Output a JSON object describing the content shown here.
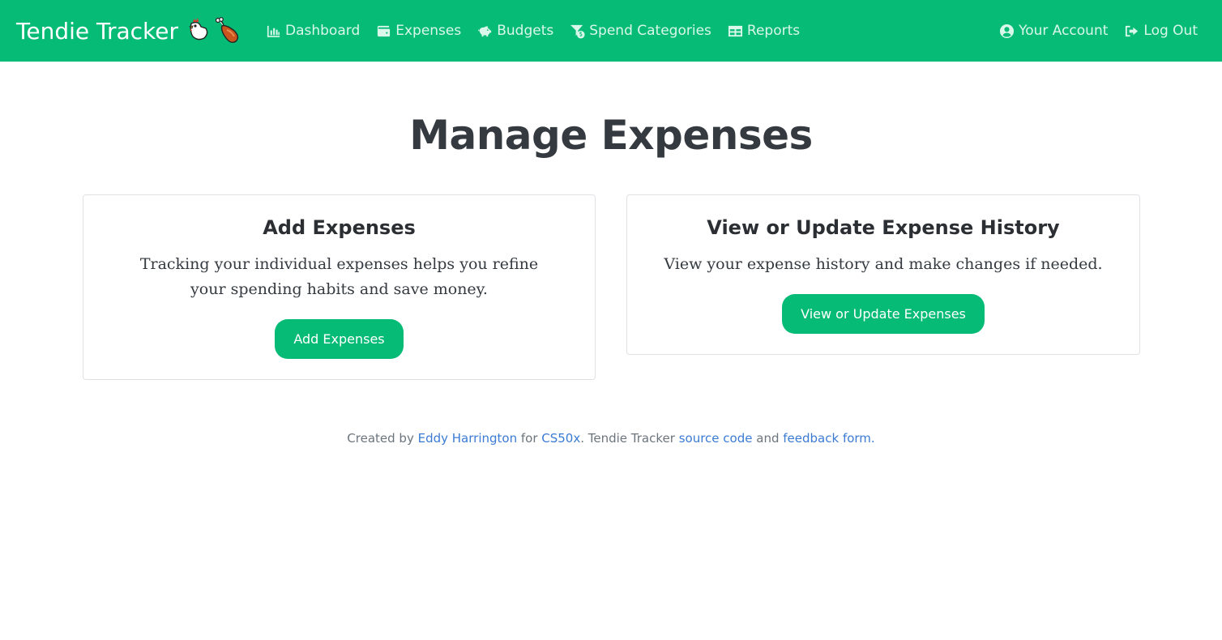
{
  "navbar": {
    "brand": "Tendie Tracker",
    "brand_emoji": [
      "chicken-icon",
      "drumstick-icon"
    ],
    "left_links": [
      {
        "label": "Dashboard",
        "icon": "bar-chart-icon"
      },
      {
        "label": "Expenses",
        "icon": "wallet-icon"
      },
      {
        "label": "Budgets",
        "icon": "piggy-bank-icon"
      },
      {
        "label": "Spend Categories",
        "icon": "funnel-dollar-icon"
      },
      {
        "label": "Reports",
        "icon": "table-icon"
      }
    ],
    "right_links": [
      {
        "label": "Your Account",
        "icon": "user-circle-icon"
      },
      {
        "label": "Log Out",
        "icon": "sign-out-icon"
      }
    ]
  },
  "main": {
    "title": "Manage Expenses",
    "cards": [
      {
        "heading": "Add Expenses",
        "text": "Tracking your individual expenses helps you refine your spending habits and save money.",
        "button": "Add Expenses"
      },
      {
        "heading": "View or Update Expense History",
        "text": "View your expense history and make changes if needed.",
        "button": "View or Update Expenses"
      }
    ]
  },
  "footer": {
    "created_by": "Created by",
    "author": "Eddy Harrington",
    "for": "for",
    "course": "CS50x",
    "middle": ". Tendie Tracker",
    "source_code": "source code",
    "and": "and",
    "feedback": "feedback form",
    "end": "."
  },
  "colors": {
    "brand_green": "#06bb76",
    "link_blue": "#3b7bd4",
    "text_dark": "#343a40",
    "footer_gray": "#6c757d"
  }
}
